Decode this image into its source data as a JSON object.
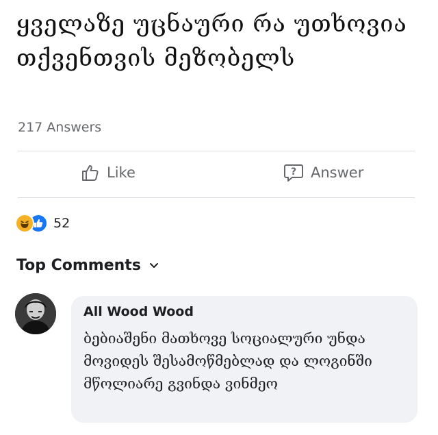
{
  "question": {
    "text": "ყველაზე უცნაური რა უთხოვია თქვენთვის მეზობელს",
    "answers_count": "217 Answers"
  },
  "actions": {
    "like_label": "Like",
    "answer_label": "Answer"
  },
  "reactions": {
    "count": "52",
    "icons": [
      "haha-reaction-icon",
      "like-reaction-icon"
    ]
  },
  "comments": {
    "section_label": "Top Comments",
    "items": [
      {
        "author": "All Wood Wood",
        "text": "ბებიაშენი მათხოვე სოციალური უნდა მოვიდეს შესამოწმებლად და ლოგინში მწოლიარე გვინდა ვინმეო"
      }
    ]
  },
  "colors": {
    "muted_text": "#65676b",
    "bubble_bg": "#f0f2f5",
    "like_blue": "#1877f2",
    "haha_yellow": "#f7b125"
  }
}
